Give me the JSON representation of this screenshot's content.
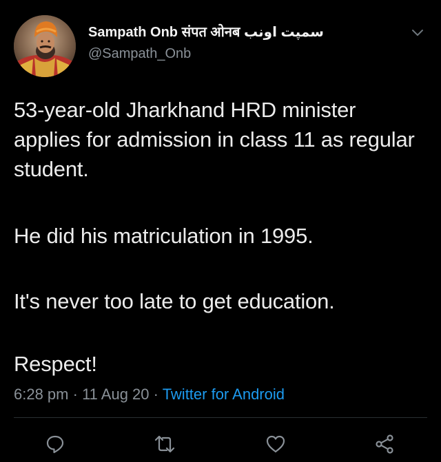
{
  "tweet": {
    "author": {
      "display_name": "Sampath Onb संपत ओनब سمپت اونب",
      "handle": "@Sampath_Onb",
      "avatar_icon": "avatar-turban-portrait"
    },
    "menu_icon": "chevron-down-icon",
    "text": {
      "paragraph1": "53-year-old Jharkhand HRD minister applies for admission in class 11 as regular student.",
      "paragraph2": "He did his matriculation in 1995.",
      "paragraph3": "It's never too late to get education.",
      "paragraph4": "Respect!"
    },
    "meta": {
      "time": "6:28 pm",
      "separator1": " · ",
      "date": "11 Aug 20",
      "separator2": " · ",
      "source": "Twitter for Android"
    },
    "actions": [
      {
        "name": "reply",
        "icon": "reply-icon"
      },
      {
        "name": "retweet",
        "icon": "retweet-icon"
      },
      {
        "name": "like",
        "icon": "heart-icon"
      },
      {
        "name": "share",
        "icon": "share-icon"
      }
    ]
  },
  "colors": {
    "background": "#000000",
    "text": "#ececec",
    "secondary": "#8a9198",
    "link": "#1d9bf0",
    "divider": "#2a2f33"
  }
}
